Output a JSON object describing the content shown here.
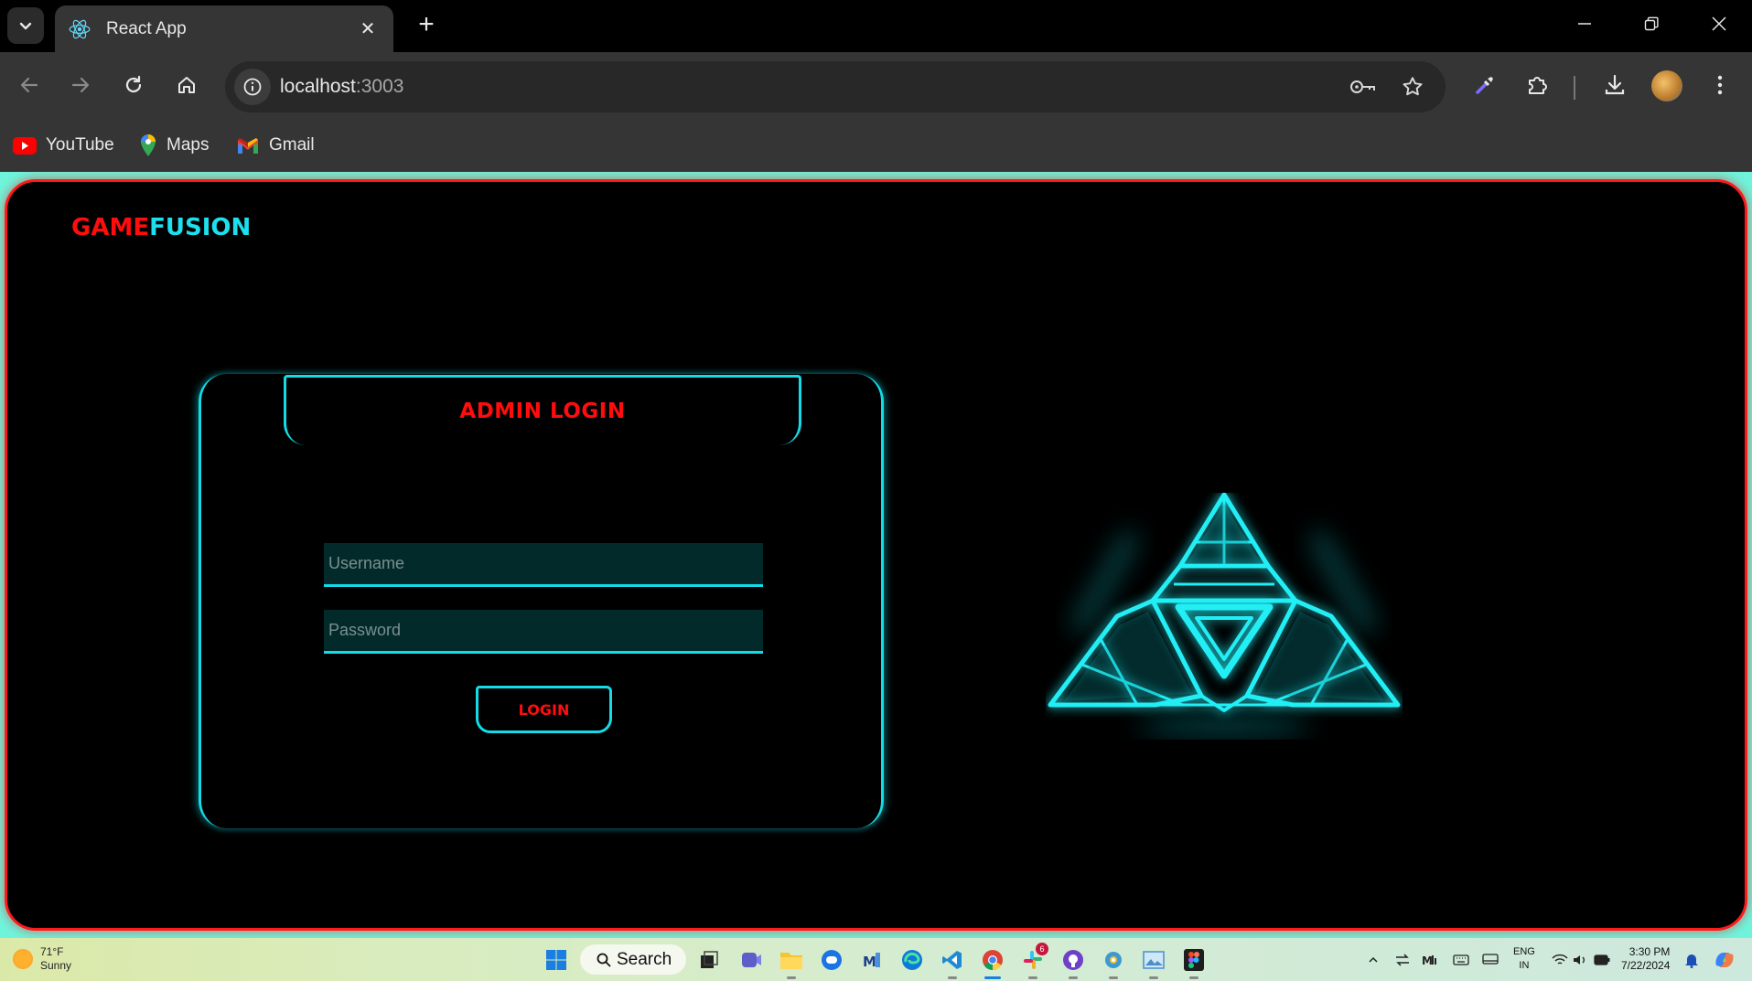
{
  "browser": {
    "tab": {
      "title": "React App",
      "icon": "react-icon"
    },
    "address": {
      "host": "localhost",
      "port": ":3003"
    },
    "bookmarks": [
      {
        "label": "YouTube",
        "icon": "youtube-icon"
      },
      {
        "label": "Maps",
        "icon": "maps-icon"
      },
      {
        "label": "Gmail",
        "icon": "gmail-icon"
      }
    ]
  },
  "page": {
    "logo": {
      "part1": "GAME",
      "part2": "FUSION"
    },
    "login": {
      "title": "ADMIN LOGIN",
      "username_placeholder": "Username",
      "password_placeholder": "Password",
      "button_label": "LOGIN"
    },
    "colors": {
      "accent_cyan": "#14dbe6",
      "accent_red": "#ff0d0d",
      "page_bg": "#000000",
      "chrome_bg": "#6ff4dc"
    }
  },
  "taskbar": {
    "weather": {
      "temp": "71°F",
      "condition": "Sunny"
    },
    "search_label": "Search",
    "language": {
      "line1": "ENG",
      "line2": "IN"
    },
    "clock": {
      "time": "3:30 PM",
      "date": "7/22/2024"
    },
    "slack_badge": "6"
  }
}
